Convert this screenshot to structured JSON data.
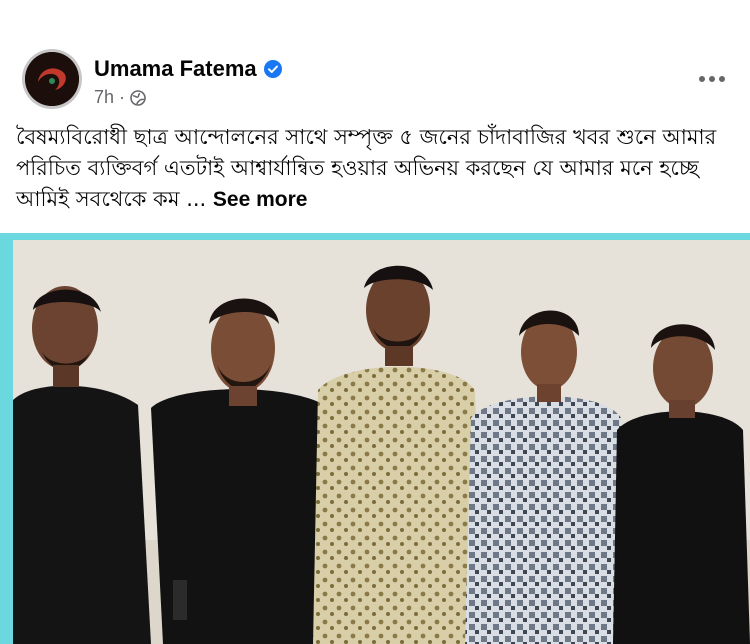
{
  "post": {
    "author_name": "Umama Fatema",
    "timestamp": "7h",
    "meta_separator": "·",
    "privacy_icon": "globe-icon",
    "verified_icon": "verified-badge-icon",
    "more_icon": "more-options-icon",
    "text": "বৈষম্যবিরোধী ছাত্র আন্দোলনের সাথে সম্পৃক্ত ৫ জনের চাঁদাবাজির খবর শুনে আমার পরিচিত ব্যক্তিবর্গ এতটাই আশ্বার্যান্বিত হওয়ার অভিনয় করছেন যে আমার মনে হচ্ছে আমিই সবথেকে কম ...",
    "see_more_label": "See more"
  },
  "colors": {
    "verified": "#1877f2",
    "secondary_text": "#65676b",
    "photo_border": "#6ad8de"
  }
}
